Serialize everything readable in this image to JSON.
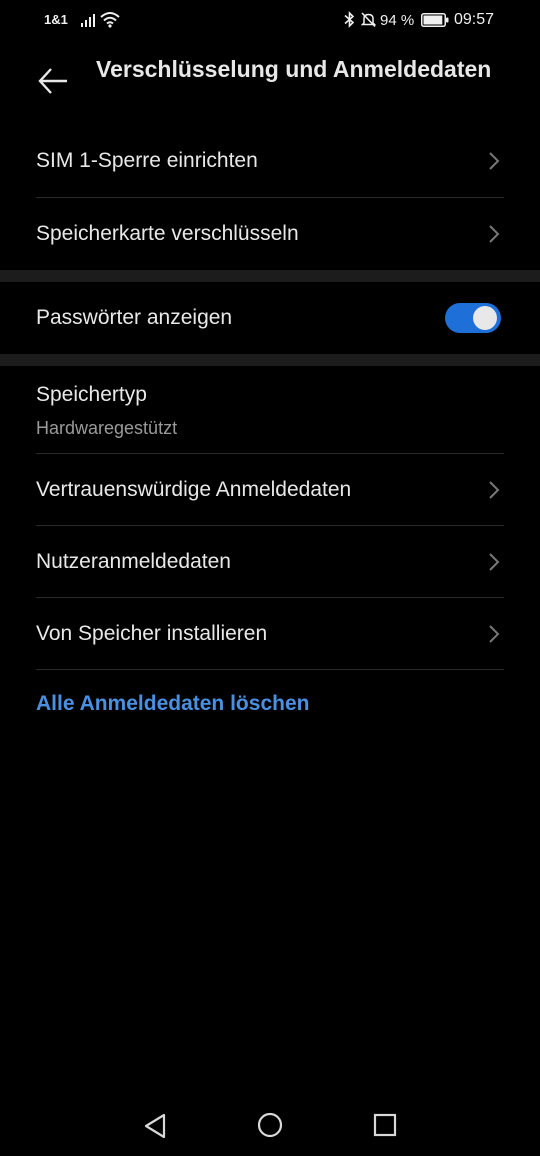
{
  "status_bar": {
    "carrier": "1&1",
    "battery_percent": "94 %",
    "battery_level": 0.94,
    "time": "09:57",
    "icons": [
      "signal-icon",
      "wifi-icon",
      "bluetooth-icon",
      "bell-off-icon",
      "battery-icon"
    ]
  },
  "header": {
    "title": "Verschlüsselung und Anmeldedaten",
    "back_icon": "arrow-left-icon"
  },
  "settings": {
    "sim_lock": {
      "label": "SIM 1-Sperre einrichten"
    },
    "sd_encrypt": {
      "label": "Speicherkarte verschlüsseln"
    },
    "show_passwords": {
      "label": "Passwörter anzeigen",
      "enabled": true
    },
    "storage_type": {
      "label": "Speichertyp",
      "value": "Hardwaregestützt"
    },
    "trusted_credentials": {
      "label": "Vertrauenswürdige Anmeldedaten"
    },
    "user_credentials": {
      "label": "Nutzeranmeldedaten"
    },
    "install_from_storage": {
      "label": "Von Speicher installieren"
    },
    "clear_credentials": {
      "label": "Alle Anmeldedaten löschen"
    }
  },
  "colors": {
    "background": "#000000",
    "text": "#e8e8e8",
    "secondary_text": "#9a9a9a",
    "accent": "#4a90e2",
    "toggle_on": "#1f6fd8",
    "section_separator": "#1c1c1c"
  },
  "nav_bar": {
    "icons": [
      "nav-back-icon",
      "nav-home-icon",
      "nav-recent-apps-icon"
    ]
  }
}
